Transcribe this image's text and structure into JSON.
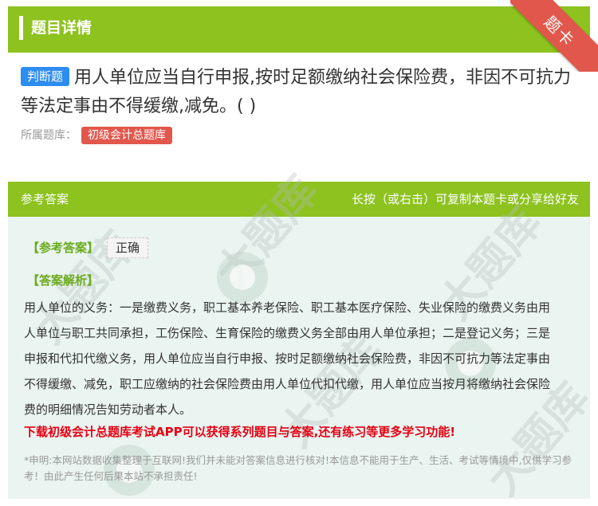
{
  "header": {
    "title": "题目详情"
  },
  "ribbon": {
    "label": "题卡"
  },
  "question": {
    "type_tag": "判断题",
    "text": "用人单位应当自行申报,按时足额缴纳社会保险费，非因不可抗力等法定事由不得缓缴,减免。( )",
    "category_label": "所属题库：",
    "category": "初级会计总题库"
  },
  "answer_card": {
    "header_left": "参考答案",
    "header_right": "长按（或右击）可复制本题卡或分享给好友",
    "ref_answer_label": "【参考答案】",
    "ref_answer_value": "正确",
    "analysis_label": "【答案解析】",
    "analysis_text": "用人单位的义务：一是缴费义务，职工基本养老保险、职工基本医疗保险、失业保险的缴费义务由用人单位与职工共同承担，工伤保险、生育保险的缴费义务全部由用人单位承担；二是登记义务；三是申报和代扣代缴义务，用人单位应当自行申报、按时足额缴纳社会保险费，非因不可抗力等法定事由不得缓缴、减免，职工应缴纳的社会保险费由用人单位代扣代缴，用人单位应当按月将缴纳社会保险费的明细情况告知劳动者本人。",
    "promo": "下载初级会计总题库考试APP可以获得系列题目与答案,还有练习等更多学习功能!",
    "disclaimer": "*申明:本网站数据收集整理于互联网!我们并未能对答案信息进行核对!本信息不能用于生产、生活、考试等情境中,仅供学习参考！由此产生任何后果本站不承担责任!"
  },
  "colors": {
    "brand_green": "#8dc21f",
    "ribbon_red": "#e2574c",
    "tag_blue": "#2d8cf0",
    "promo_red": "#e60012"
  }
}
